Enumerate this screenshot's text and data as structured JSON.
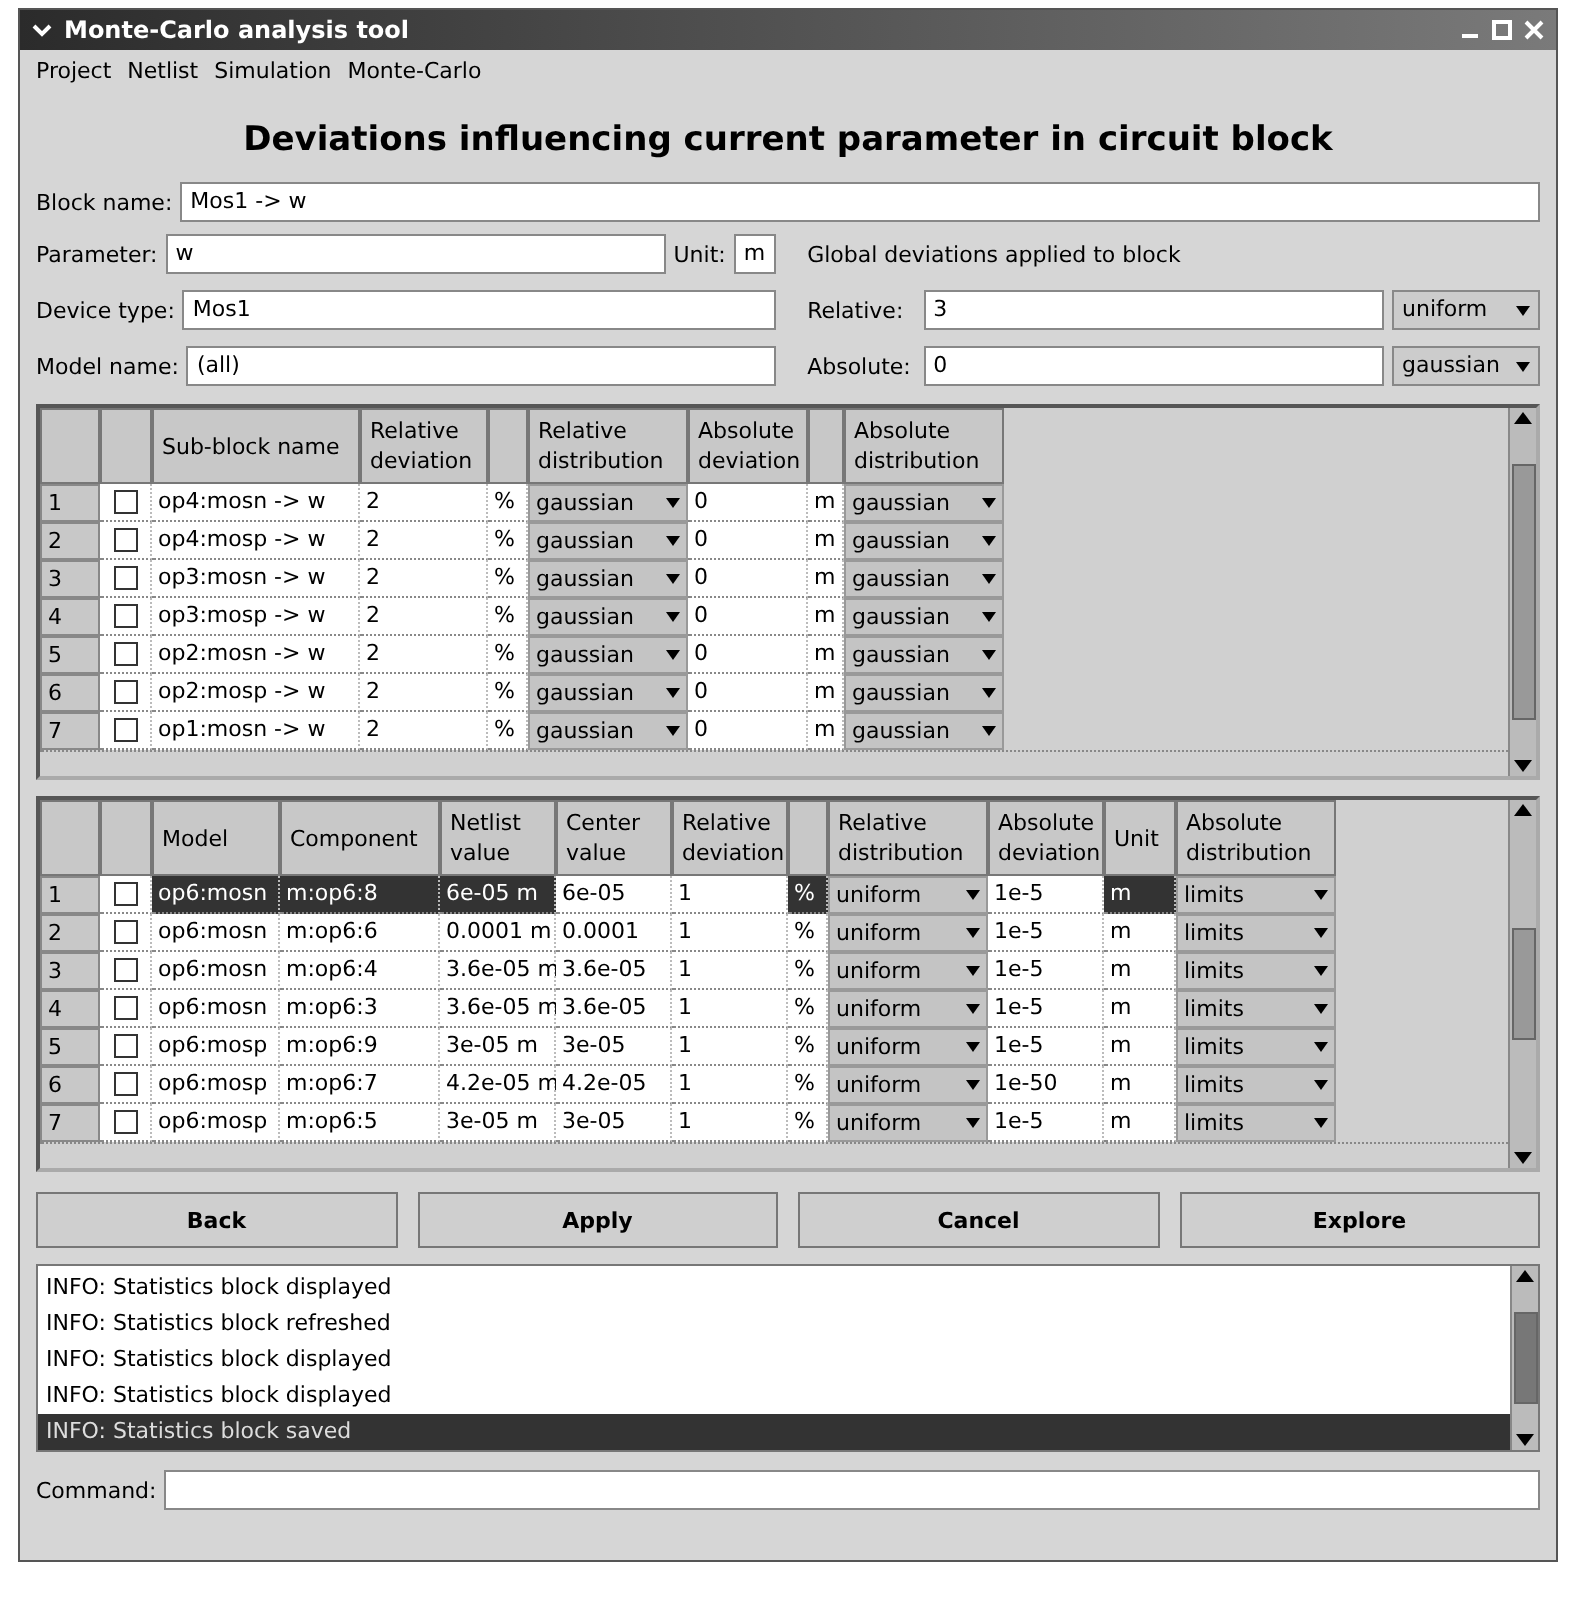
{
  "window": {
    "title": "Monte-Carlo analysis tool"
  },
  "menu": [
    "Project",
    "Netlist",
    "Simulation",
    "Monte-Carlo"
  ],
  "heading": "Deviations influencing current parameter in circuit block",
  "block_name": {
    "label": "Block name:",
    "value": "Mos1 -> w"
  },
  "parameter": {
    "label": "Parameter:",
    "value": "w"
  },
  "unit": {
    "label": "Unit:",
    "value": "m"
  },
  "device_type": {
    "label": "Device type:",
    "value": "Mos1"
  },
  "model_name": {
    "label": "Model name:",
    "value": "(all)"
  },
  "global_deviations": {
    "title": "Global deviations applied to block",
    "relative": {
      "label": "Relative:",
      "value": "3",
      "distribution": "uniform"
    },
    "absolute": {
      "label": "Absolute:",
      "value": "0",
      "distribution": "gaussian"
    }
  },
  "upper_table": {
    "columns": [
      "Sub-block name",
      "Relative deviation",
      "Relative distribution",
      "Absolute deviation",
      "Absolute distribution"
    ],
    "rows": [
      {
        "number": "1",
        "checked": false,
        "name": "op4:mosn -> w",
        "rel_dev": "2",
        "rel_unit": "%",
        "rel_dist": "gaussian",
        "abs_dev": "0",
        "abs_unit": "m",
        "abs_dist": "gaussian"
      },
      {
        "number": "2",
        "checked": false,
        "name": "op4:mosp -> w",
        "rel_dev": "2",
        "rel_unit": "%",
        "rel_dist": "gaussian",
        "abs_dev": "0",
        "abs_unit": "m",
        "abs_dist": "gaussian"
      },
      {
        "number": "3",
        "checked": false,
        "name": "op3:mosn -> w",
        "rel_dev": "2",
        "rel_unit": "%",
        "rel_dist": "gaussian",
        "abs_dev": "0",
        "abs_unit": "m",
        "abs_dist": "gaussian"
      },
      {
        "number": "4",
        "checked": false,
        "name": "op3:mosp -> w",
        "rel_dev": "2",
        "rel_unit": "%",
        "rel_dist": "gaussian",
        "abs_dev": "0",
        "abs_unit": "m",
        "abs_dist": "gaussian"
      },
      {
        "number": "5",
        "checked": false,
        "name": "op2:mosn -> w",
        "rel_dev": "2",
        "rel_unit": "%",
        "rel_dist": "gaussian",
        "abs_dev": "0",
        "abs_unit": "m",
        "abs_dist": "gaussian"
      },
      {
        "number": "6",
        "checked": false,
        "name": "op2:mosp -> w",
        "rel_dev": "2",
        "rel_unit": "%",
        "rel_dist": "gaussian",
        "abs_dev": "0",
        "abs_unit": "m",
        "abs_dist": "gaussian"
      },
      {
        "number": "7",
        "checked": false,
        "name": "op1:mosn -> w",
        "rel_dev": "2",
        "rel_unit": "%",
        "rel_dist": "gaussian",
        "abs_dev": "0",
        "abs_unit": "m",
        "abs_dist": "gaussian"
      }
    ]
  },
  "lower_table": {
    "columns": [
      "Model",
      "Component",
      "Netlist value",
      "Center value",
      "Relative deviation",
      "Relative distribution",
      "Absolute deviation",
      "Unit",
      "Absolute distribution"
    ],
    "rows": [
      {
        "number": "1",
        "selected": true,
        "checked": false,
        "model": "op6:mosn",
        "component": "m:op6:8",
        "netlist_value": "6e-05 m",
        "center_value": "6e-05",
        "rel_dev": "1",
        "rel_unit": "%",
        "rel_dist": "uniform",
        "abs_dev": "1e-5",
        "unit": "m",
        "abs_dist": "limits"
      },
      {
        "number": "2",
        "selected": false,
        "checked": false,
        "model": "op6:mosn",
        "component": "m:op6:6",
        "netlist_value": "0.0001 m",
        "center_value": "0.0001",
        "rel_dev": "1",
        "rel_unit": "%",
        "rel_dist": "uniform",
        "abs_dev": "1e-5",
        "unit": "m",
        "abs_dist": "limits"
      },
      {
        "number": "3",
        "selected": false,
        "checked": false,
        "model": "op6:mosn",
        "component": "m:op6:4",
        "netlist_value": "3.6e-05 m",
        "center_value": "3.6e-05",
        "rel_dev": "1",
        "rel_unit": "%",
        "rel_dist": "uniform",
        "abs_dev": "1e-5",
        "unit": "m",
        "abs_dist": "limits"
      },
      {
        "number": "4",
        "selected": false,
        "checked": false,
        "model": "op6:mosn",
        "component": "m:op6:3",
        "netlist_value": "3.6e-05 m",
        "center_value": "3.6e-05",
        "rel_dev": "1",
        "rel_unit": "%",
        "rel_dist": "uniform",
        "abs_dev": "1e-5",
        "unit": "m",
        "abs_dist": "limits"
      },
      {
        "number": "5",
        "selected": false,
        "checked": false,
        "model": "op6:mosp",
        "component": "m:op6:9",
        "netlist_value": "3e-05 m",
        "center_value": "3e-05",
        "rel_dev": "1",
        "rel_unit": "%",
        "rel_dist": "uniform",
        "abs_dev": "1e-5",
        "unit": "m",
        "abs_dist": "limits"
      },
      {
        "number": "6",
        "selected": false,
        "checked": false,
        "model": "op6:mosp",
        "component": "m:op6:7",
        "netlist_value": "4.2e-05 m",
        "center_value": "4.2e-05",
        "rel_dev": "1",
        "rel_unit": "%",
        "rel_dist": "uniform",
        "abs_dev": "1e-50",
        "unit": "m",
        "abs_dist": "limits"
      },
      {
        "number": "7",
        "selected": false,
        "checked": false,
        "model": "op6:mosp",
        "component": "m:op6:5",
        "netlist_value": "3e-05 m",
        "center_value": "3e-05",
        "rel_dev": "1",
        "rel_unit": "%",
        "rel_dist": "uniform",
        "abs_dev": "1e-5",
        "unit": "m",
        "abs_dist": "limits"
      }
    ]
  },
  "buttons": [
    "Back",
    "Apply",
    "Cancel",
    "Explore"
  ],
  "log": [
    {
      "text": "INFO: Statistics block displayed",
      "selected": false
    },
    {
      "text": "INFO: Statistics block refreshed",
      "selected": false
    },
    {
      "text": "INFO: Statistics block displayed",
      "selected": false
    },
    {
      "text": "INFO: Statistics block displayed",
      "selected": false
    },
    {
      "text": "INFO: Statistics block saved",
      "selected": true
    }
  ],
  "command": {
    "label": "Command:"
  }
}
